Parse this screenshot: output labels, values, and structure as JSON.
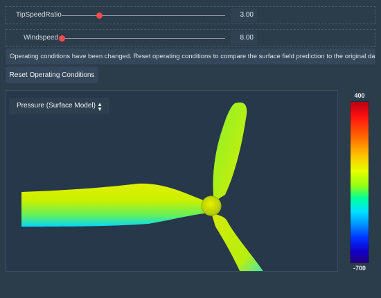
{
  "sliders": [
    {
      "label": "TipSpeedRatio",
      "value": "3.00",
      "fraction": 0.23
    },
    {
      "label": "Windspeed",
      "value": "8.00",
      "fraction": 0.0
    }
  ],
  "message": "Operating conditions have been changed. Reset operating conditions to compare the surface field prediction to the original data.",
  "reset_button": "Reset Operating Conditions",
  "viewer": {
    "field_select": "Pressure (Surface Model)",
    "field_select_icon": "up-down-chevron-icon"
  },
  "colorbar": {
    "max_label": "400",
    "min_label": "-700"
  },
  "colors": {
    "background": "#2b3c4b",
    "panel": "#34485a",
    "slider_thumb": "#ff4b4b"
  }
}
